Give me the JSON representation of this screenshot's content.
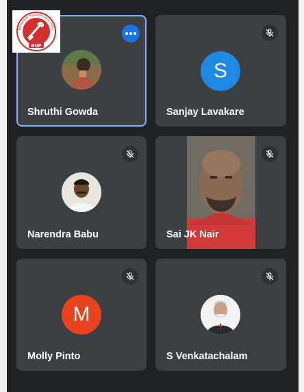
{
  "meeting": {
    "participants": [
      {
        "name": "Shruthi Gowda",
        "type": "photo",
        "pinned_menu": true
      },
      {
        "name": "Sanjay Lavakare",
        "type": "initial",
        "initial": "S",
        "color": "#1e88e5",
        "muted": true
      },
      {
        "name": "Narendra Babu",
        "type": "photo",
        "muted": true
      },
      {
        "name": "Sai JK Nair",
        "type": "video",
        "muted": true
      },
      {
        "name": "Molly Pinto",
        "type": "initial",
        "initial": "M",
        "color": "#e8431c",
        "muted": true
      },
      {
        "name": "S Venkatachalam",
        "type": "photo",
        "muted": true
      }
    ]
  },
  "logo": {
    "text": "BNP",
    "ring_text": "Bangalore NavaNirmana Party",
    "color": "#d32f2f"
  },
  "icons": {
    "mute": "mic-off-icon",
    "more": "more-options-icon"
  },
  "colors": {
    "active_border": "#8ab4f8",
    "tile_bg": "#3c4043",
    "background": "#202124"
  }
}
